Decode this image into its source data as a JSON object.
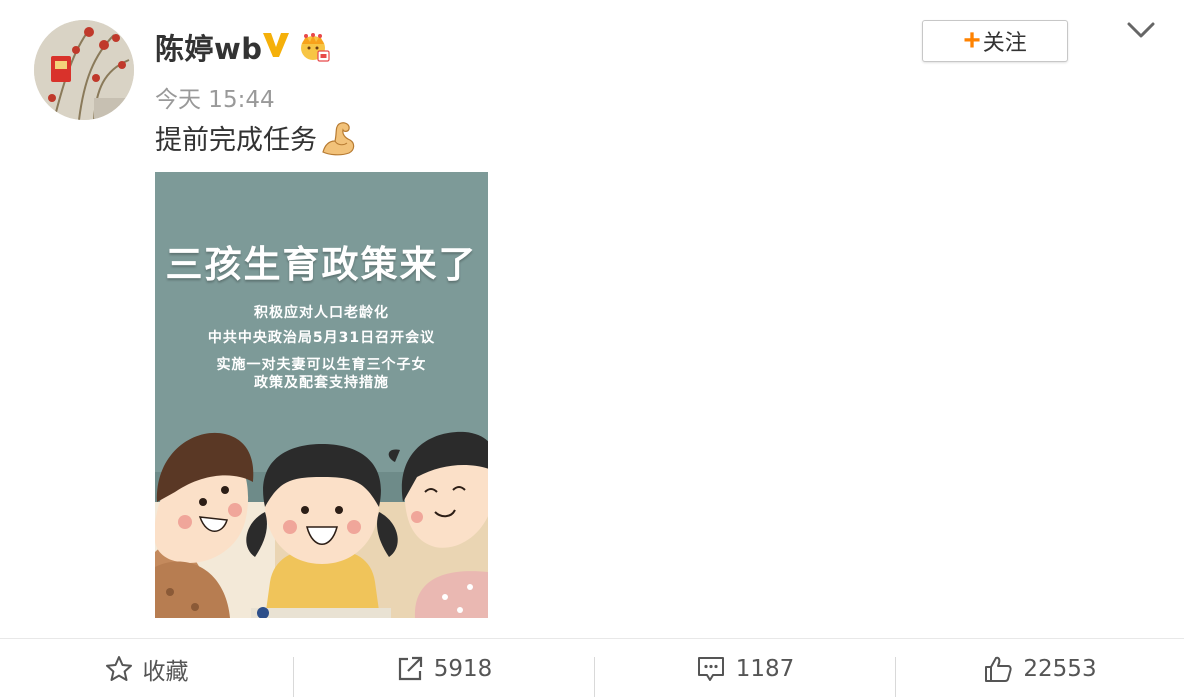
{
  "author": {
    "name": "陈婷wb",
    "verified_badge": "V",
    "timestamp": "今天 15:44"
  },
  "follow": {
    "label": "关注"
  },
  "post": {
    "text": "提前完成任务",
    "emoji": "flexed-biceps-icon"
  },
  "poster": {
    "title": "三孩生育政策来了",
    "lines": [
      "积极应对人口老龄化",
      "中共中央政治局5月31日召开会议",
      "实施一对夫妻可以生育三个子女",
      "政策及配套支持措施"
    ]
  },
  "actions": {
    "favorite_label": "收藏",
    "repost_count": "5918",
    "comment_count": "1187",
    "like_count": "22553"
  },
  "colors": {
    "accent": "#ff8200",
    "verified": "#f5b00a",
    "poster_bg": "#7d9a98"
  }
}
